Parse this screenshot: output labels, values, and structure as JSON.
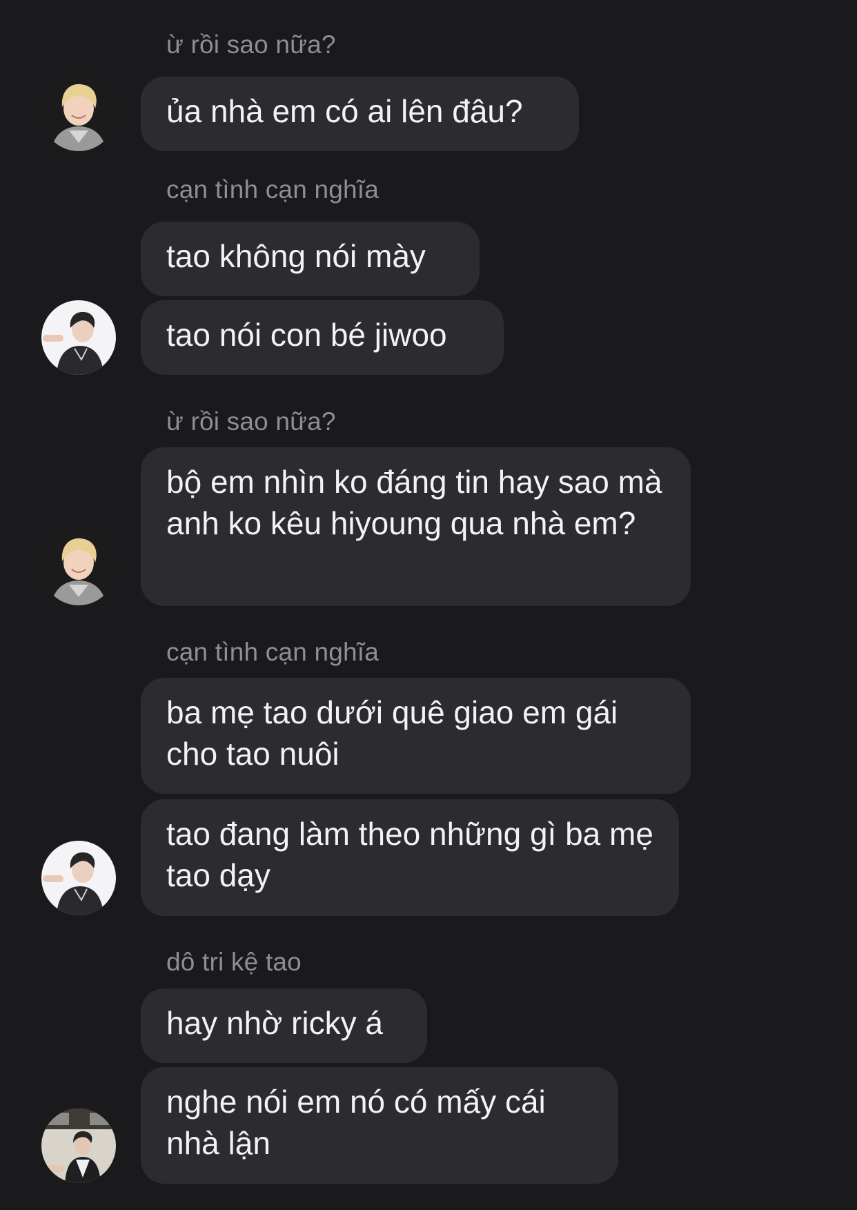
{
  "messages": [
    {
      "sender": "ừ rồi sao nữa?",
      "text": "ủa nhà em có ai lên đâu?"
    },
    {
      "sender": "cạn tình cạn nghĩa",
      "text": "tao không nói mày"
    },
    {
      "text": "tao nói con bé jiwoo"
    },
    {
      "sender": "ừ rồi sao nữa?",
      "text": "bộ em nhìn ko đáng tin hay sao mà anh ko kêu hiyoung qua nhà em?"
    },
    {
      "sender": "cạn tình cạn nghĩa",
      "text": "ba mẹ tao dưới quê giao em gái cho tao nuôi"
    },
    {
      "text": "tao đang làm theo những gì ba mẹ tao dạy"
    },
    {
      "sender": "dô tri kệ tao",
      "text": "hay nhờ ricky á"
    },
    {
      "text": "nghe nói em nó có mấy cái nhà lận"
    }
  ],
  "colors": {
    "background": "#1a1a1c",
    "bubble": "#2c2c2e",
    "message_text": "#f2f2f7",
    "sender_text": "#8e8e93"
  },
  "icons": {
    "avatar_1": "avatar-blonde-person",
    "avatar_2": "avatar-dark-hair-person-white-bg",
    "avatar_3": "avatar-person-dark-jacket"
  }
}
